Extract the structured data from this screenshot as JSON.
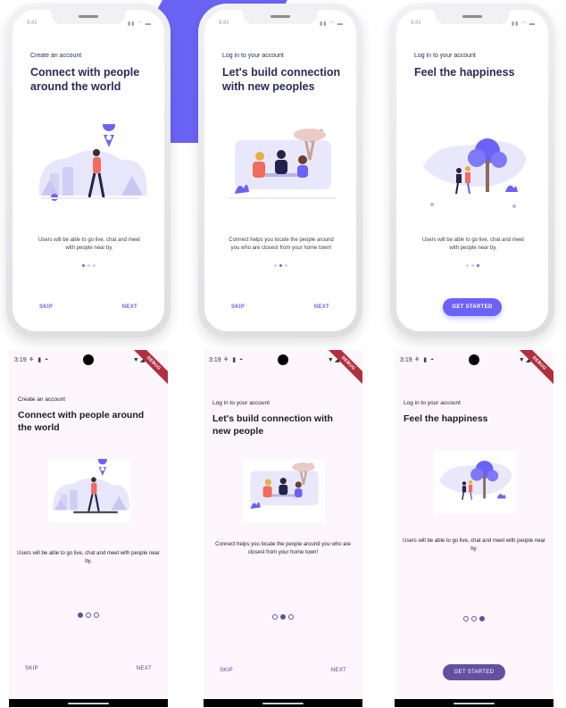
{
  "ios": {
    "time": "9:41",
    "status_icons": "▮▮ ◠ ▬",
    "screens": [
      {
        "subtitle": "Create an account",
        "title": "Connect with people around the world",
        "description": "Users will be able to go live, chat and meet with people near by.",
        "skip": "SKIP",
        "next": "NEXT",
        "active_dot": 0
      },
      {
        "subtitle": "Log in to your account",
        "title": "Let's build connection with new peoples",
        "description": "Connect helps you locate the people around you who are closest from your home town!",
        "skip": "SKIP",
        "next": "NEXT",
        "active_dot": 1
      },
      {
        "subtitle": "Log in to your account",
        "title": "Feel the happiness",
        "description": "Users will be able to go live, chat and meet with people near by.",
        "get_started": "GET STARTED",
        "active_dot": 2
      }
    ]
  },
  "android": {
    "time": "3:19",
    "status_icons": "⚘ ▮ ◓",
    "right_icons": "▼◢▮",
    "debug_banner": "DEBUG",
    "screens": [
      {
        "subtitle": "Create an account",
        "title": "Connect with people around the world",
        "description": "Users will be able to go live, chat and meet with people near by.",
        "skip": "SKIP",
        "next": "NEXT",
        "active_dot": 0
      },
      {
        "subtitle": "Log in to your account",
        "title": "Let's build connection with new people",
        "description": "Connect helps you locate the people around you who are closest from your home town!",
        "skip": "SKIP",
        "next": "NEXT",
        "active_dot": 1
      },
      {
        "subtitle": "Log in to your account",
        "title": "Feel the happiness",
        "description": "Users will be able to go live, chat and meet with people near by.",
        "get_started": "GET STARTED",
        "active_dot": 2
      }
    ]
  },
  "colors": {
    "ios_accent": "#6b63f6",
    "android_accent": "#6350a3",
    "title_ios": "#2a2b5a",
    "android_bg": "#fdf7fd",
    "debug_banner": "#b0303f"
  }
}
